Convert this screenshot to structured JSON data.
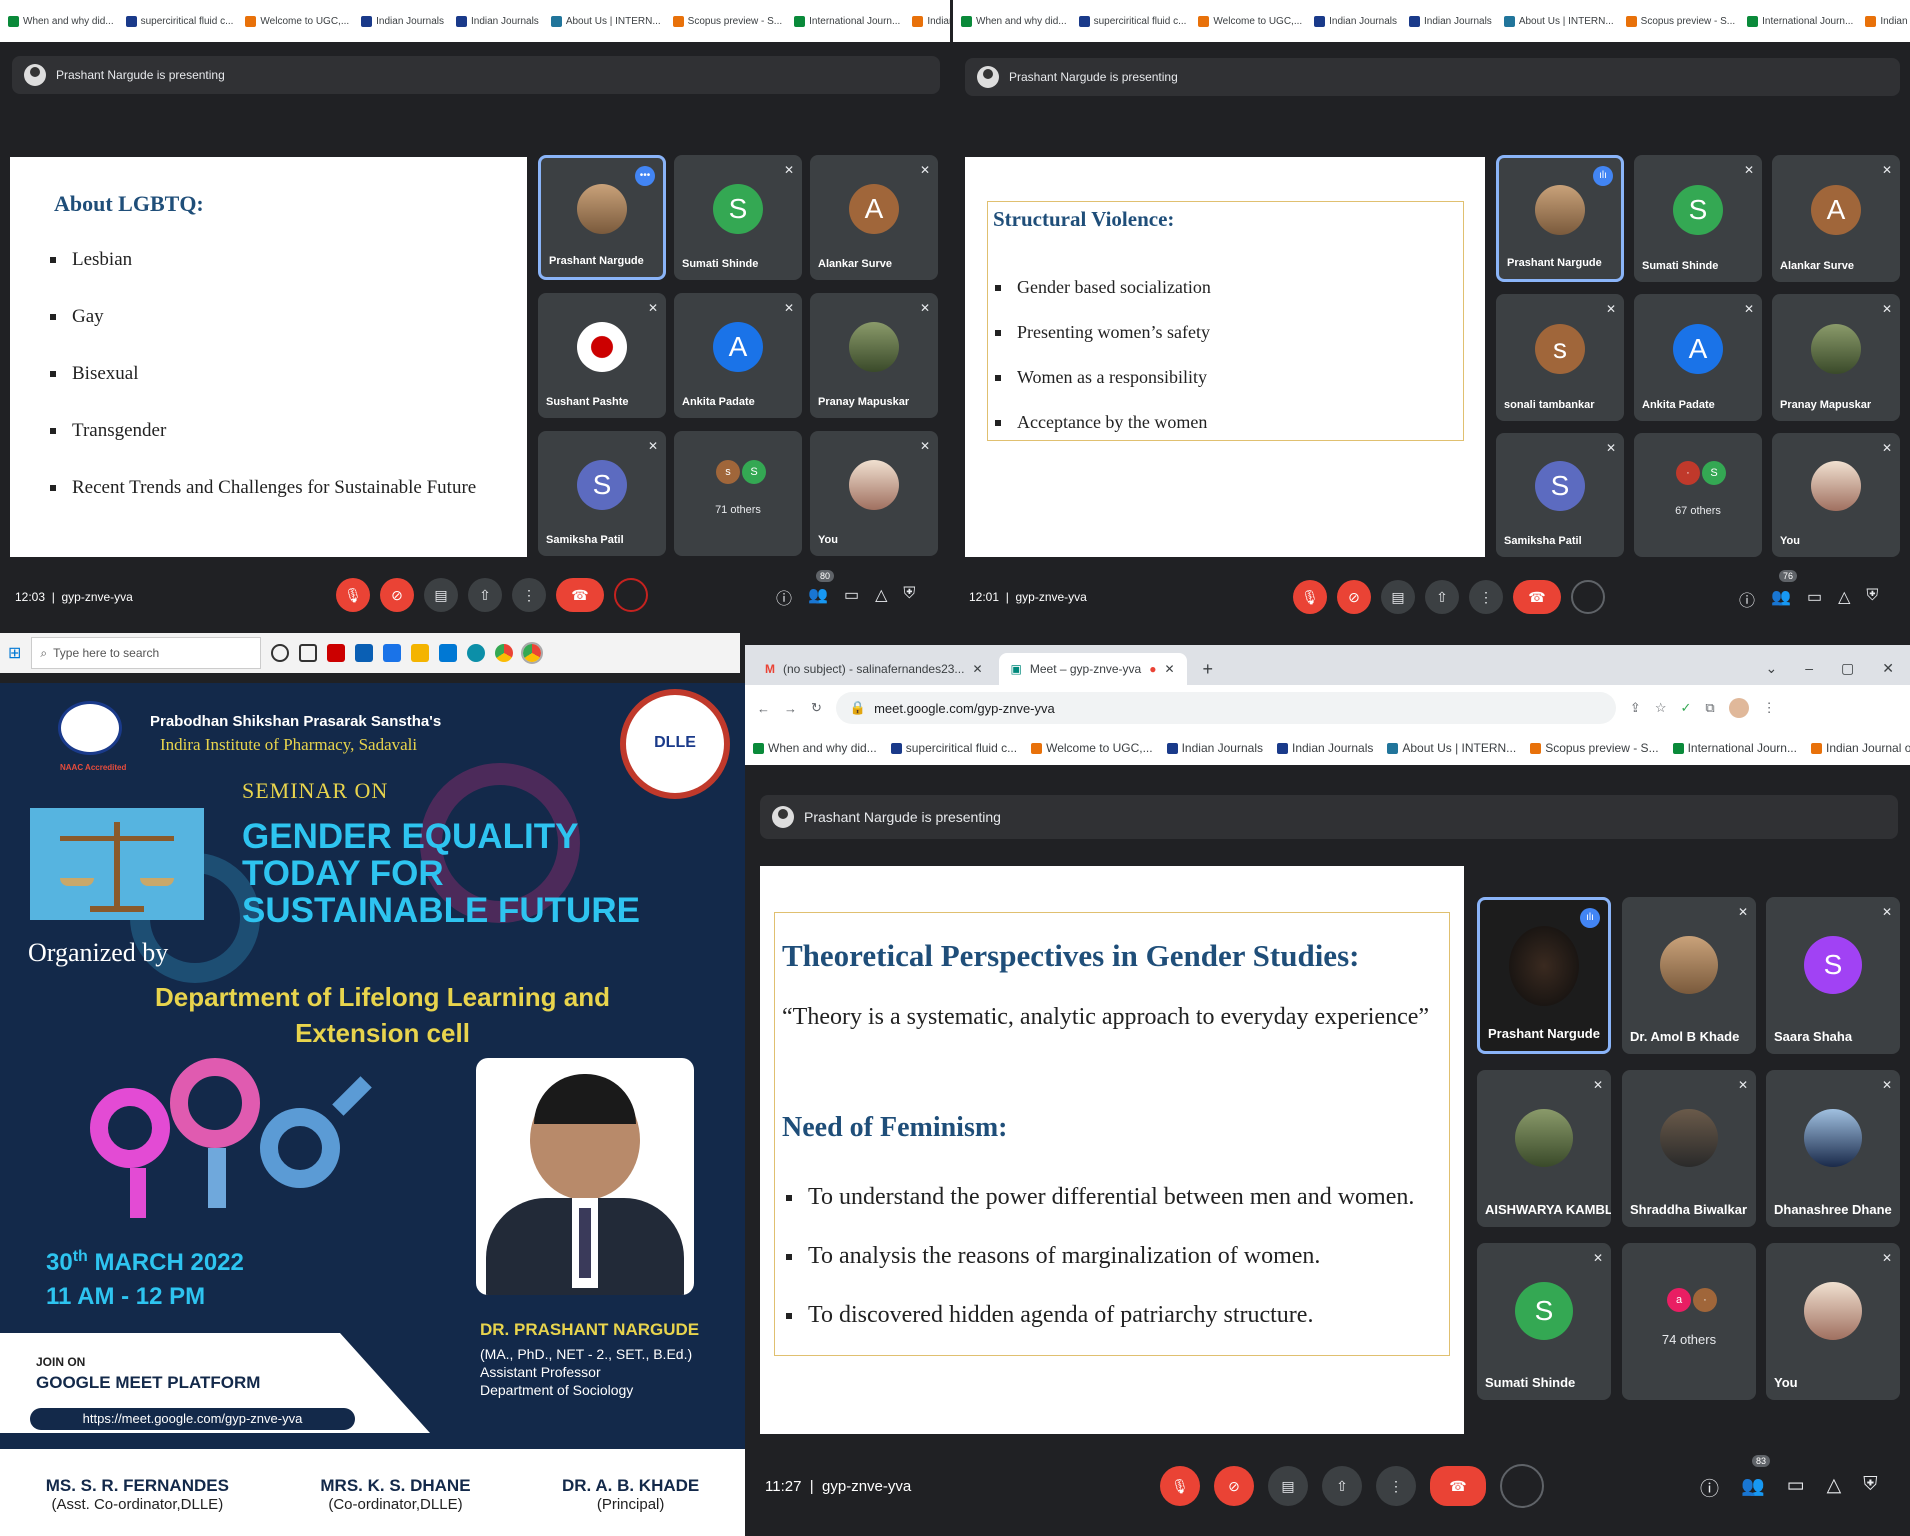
{
  "bookmarks": [
    "When and why did...",
    "superciritical fluid c...",
    "Welcome to UGC,...",
    "Indian Journals",
    "Indian Journals",
    "About Us | INTERN...",
    "Scopus preview - S...",
    "International Journ...",
    "Indian Journal of Ph..."
  ],
  "q1": {
    "presenting": "Prashant Nargude is presenting",
    "slide": {
      "title": "About LGBTQ:",
      "items": [
        "Lesbian",
        "Gay",
        "Bisexual",
        "Transgender",
        "Recent Trends and Challenges for Sustainable Future"
      ]
    },
    "tiles": [
      {
        "name": "Prashant Nargude"
      },
      {
        "name": "Sumati Shinde",
        "letter": "S"
      },
      {
        "name": "Alankar Surve",
        "letter": "A"
      },
      {
        "name": "Sushant Pashte"
      },
      {
        "name": "Ankita Padate",
        "letter": "A"
      },
      {
        "name": "Pranay Mapuskar"
      },
      {
        "name": "Samiksha Patil",
        "letter": "S"
      },
      {
        "name": "71 others"
      },
      {
        "name": "You"
      }
    ],
    "time": "12:03",
    "code": "gyp-znve-yva",
    "count": "80"
  },
  "q2": {
    "presenting": "Prashant Nargude is presenting",
    "slide": {
      "title": "Structural Violence:",
      "items": [
        "Gender based socialization",
        "Presenting women’s safety",
        "Women as a responsibility",
        "Acceptance by the women"
      ]
    },
    "tiles": [
      {
        "name": "Prashant Nargude"
      },
      {
        "name": "Sumati Shinde",
        "letter": "S"
      },
      {
        "name": "Alankar Surve",
        "letter": "A"
      },
      {
        "name": "sonali tambankar",
        "letter": "s"
      },
      {
        "name": "Ankita Padate",
        "letter": "A"
      },
      {
        "name": "Pranay Mapuskar"
      },
      {
        "name": "Samiksha Patil",
        "letter": "S"
      },
      {
        "name": "67 others"
      },
      {
        "name": "You"
      }
    ],
    "time": "12:01",
    "code": "gyp-znve-yva",
    "count": "76"
  },
  "taskbar": {
    "search": "Type here to search"
  },
  "poster": {
    "sanstha": "Prabodhan Shikshan Prasarak Sanstha's",
    "institute": "Indira Institute of Pharmacy, Sadavali",
    "naac": "NAAC Accredited",
    "seminar_on": "SEMINAR ON",
    "title": [
      "GENDER EQUALITY",
      "TODAY FOR",
      "SUSTAINABLE FUTURE"
    ],
    "organized_by": "Organized by",
    "department": [
      "Department of Lifelong Learning and",
      "Extension cell"
    ],
    "date_day": "30",
    "date_sup": "th",
    "date_rest": "MARCH 2022",
    "time": "11 AM - 12 PM",
    "join_on": "JOIN ON",
    "platform": "GOOGLE MEET PLATFORM",
    "link": "https://meet.google.com/gyp-znve-yva",
    "speaker": "DR. PRASHANT NARGUDE",
    "speaker_lines": [
      "(MA., PhD., NET - 2., SET., B.Ed.)",
      "Assistant Professor",
      "Department of Sociology"
    ],
    "footer": [
      {
        "name": "MS. S. R. FERNANDES",
        "role": "(Asst. Co-ordinator,DLLE)"
      },
      {
        "name": "MRS. K. S. DHANE",
        "role": "(Co-ordinator,DLLE)"
      },
      {
        "name": "DR. A. B. KHADE",
        "role": "(Principal)"
      }
    ],
    "seal": "DLLE"
  },
  "q4": {
    "tabs": [
      "(no subject) - salinafernandes23...",
      "Meet – gyp-znve-yva"
    ],
    "url": "meet.google.com/gyp-znve-yva",
    "presenting": "Prashant Nargude is presenting",
    "slide": {
      "title": "Theoretical Perspectives in Gender Studies:",
      "quote": "“Theory is a systematic, analytic approach to everyday experience”",
      "subtitle": "Need of Feminism:",
      "items": [
        "To understand the power differential between men and women.",
        "To analysis the reasons of marginalization of women.",
        "To discovered hidden agenda of patriarchy structure."
      ]
    },
    "tiles": [
      {
        "name": "Prashant Nargude"
      },
      {
        "name": "Dr. Amol B Khade"
      },
      {
        "name": "Saara Shaha",
        "letter": "S"
      },
      {
        "name": "AISHWARYA KAMBLE"
      },
      {
        "name": "Shraddha Biwalkar"
      },
      {
        "name": "Dhanashree Dhane"
      },
      {
        "name": "Sumati Shinde",
        "letter": "S"
      },
      {
        "name": "74 others"
      },
      {
        "name": "You"
      }
    ],
    "time": "11:27",
    "code": "gyp-znve-yva",
    "count": "83"
  },
  "colors": {
    "meet_bg": "#202124",
    "tile_bg": "#3c4043",
    "red": "#ea4335",
    "green": "#34a853",
    "blue": "#1a73e8",
    "purple": "#a142f4",
    "brown": "#a0663a",
    "poster_bg": "#13294a",
    "poster_cyan": "#2ec4f0",
    "poster_yellow": "#e8d44d"
  }
}
